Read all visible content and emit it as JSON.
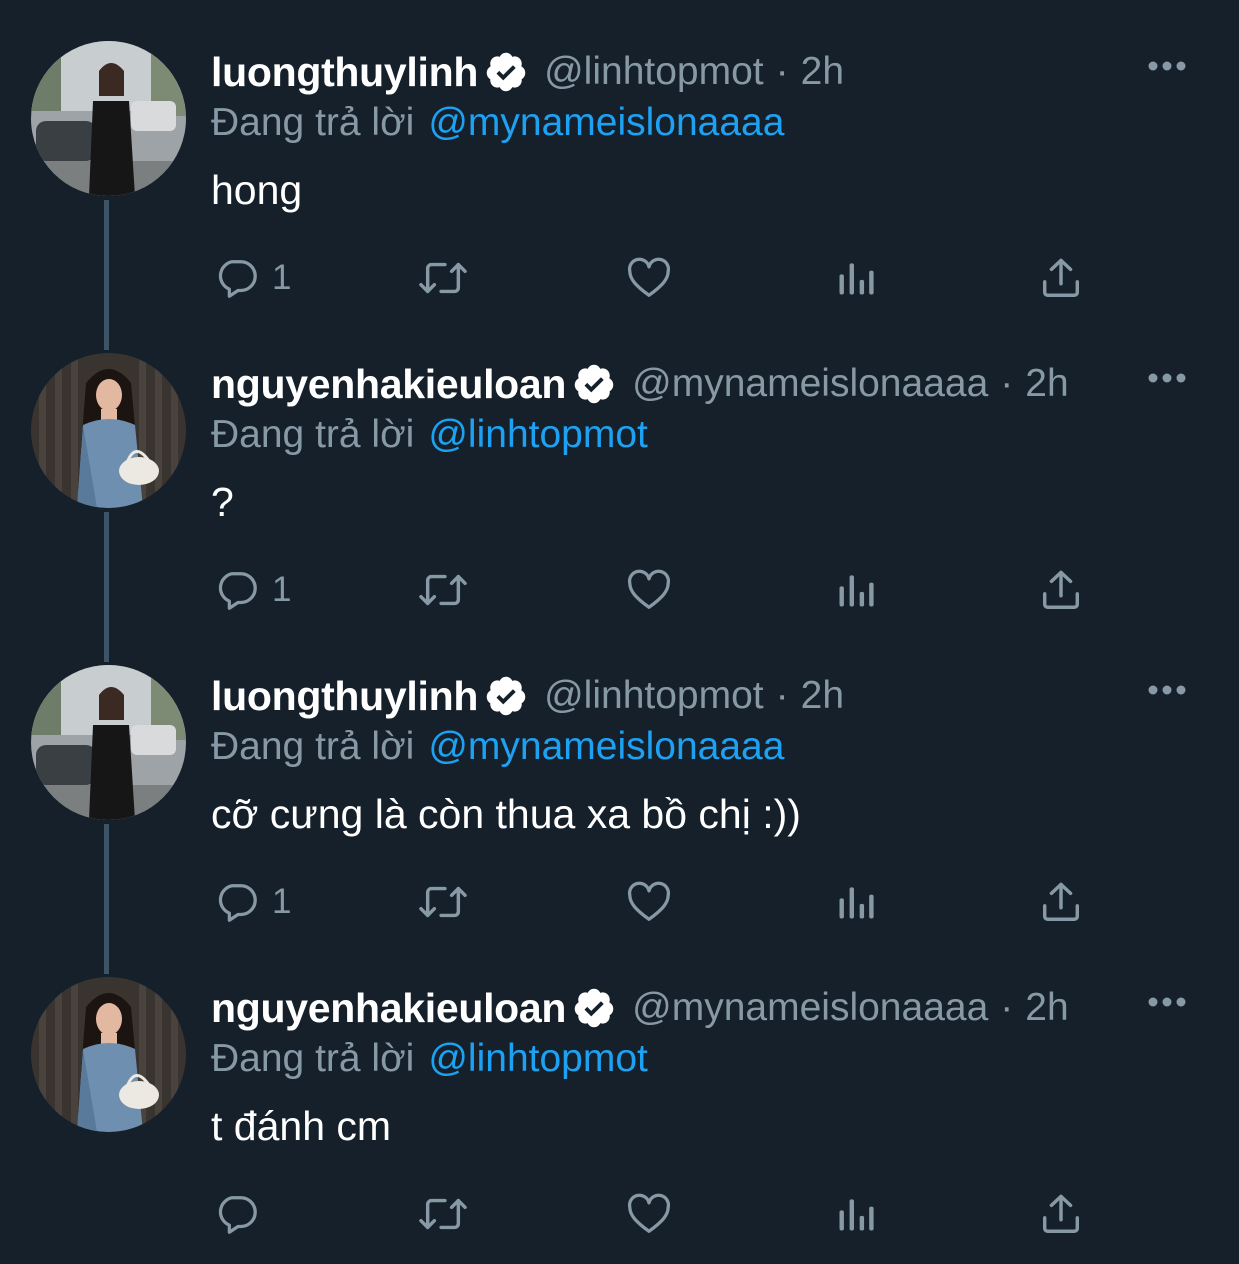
{
  "colors": {
    "background": "#15202b",
    "name": "#ffffff",
    "secondary_text": "#8899a6",
    "mention": "#1da1f2",
    "thread_line": "#3d5466",
    "verified_badge": "#ffffff"
  },
  "tweets": [
    {
      "display_name": "luongthuylinh",
      "handle": "@linhtopmot",
      "separator": "·",
      "time": "2h",
      "reply_prefix": "Đang trả lời",
      "reply_to": "@mynameislonaaaa",
      "text": "hong",
      "reply_count": "1",
      "avatar_icon": "avatar-photo-street",
      "verified_icon": "verified-badge-icon"
    },
    {
      "display_name": "nguyenhakieuloan",
      "handle": "@mynameislonaaaa",
      "separator": "·",
      "time": "2h",
      "reply_prefix": "Đang trả lời",
      "reply_to": "@linhtopmot",
      "text": "?",
      "reply_count": "1",
      "avatar_icon": "avatar-photo-denim",
      "verified_icon": "verified-badge-icon"
    },
    {
      "display_name": "luongthuylinh",
      "handle": "@linhtopmot",
      "separator": "·",
      "time": "2h",
      "reply_prefix": "Đang trả lời",
      "reply_to": "@mynameislonaaaa",
      "text": "cỡ cưng là còn thua xa bồ chị :))",
      "reply_count": "1",
      "avatar_icon": "avatar-photo-street",
      "verified_icon": "verified-badge-icon"
    },
    {
      "display_name": "nguyenhakieuloan",
      "handle": "@mynameislonaaaa",
      "separator": "·",
      "time": "2h",
      "reply_prefix": "Đang trả lời",
      "reply_to": "@linhtopmot",
      "text": "t đánh cm",
      "reply_count": "",
      "avatar_icon": "avatar-photo-denim",
      "verified_icon": "verified-badge-icon"
    }
  ],
  "action_icons": [
    "reply-icon",
    "retweet-icon",
    "like-icon",
    "analytics-icon",
    "share-icon",
    "more-icon"
  ]
}
